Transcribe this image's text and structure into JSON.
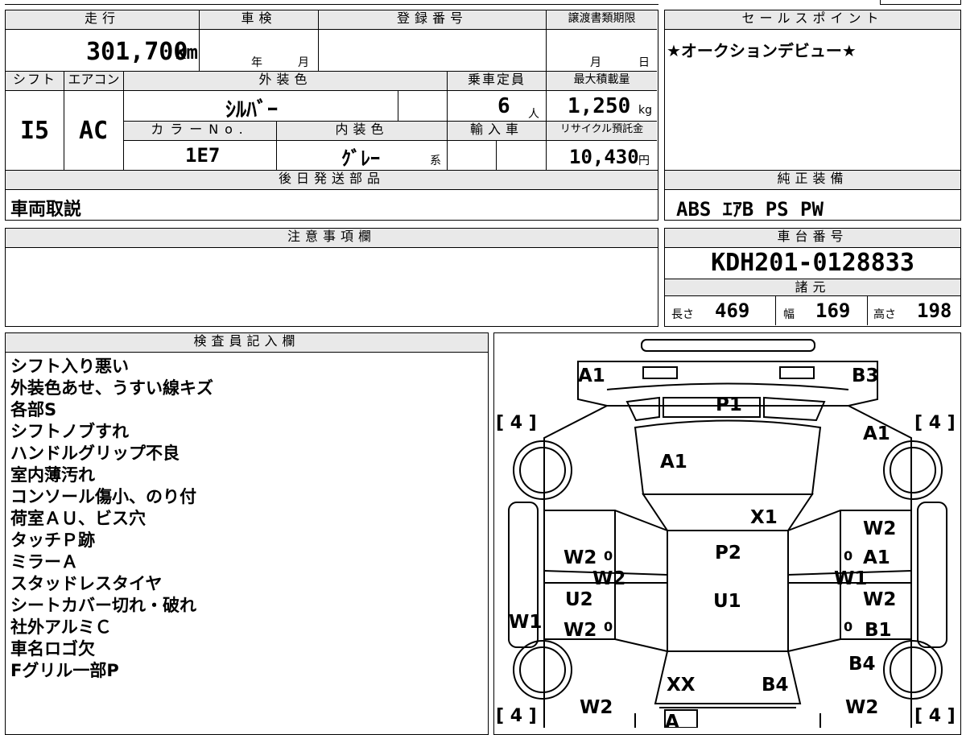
{
  "mileage": {
    "header": "走行",
    "value": "301,700",
    "unit": "km"
  },
  "inspection": {
    "header": "車検",
    "year_label": "年",
    "month_label": "月"
  },
  "registration": {
    "header": "登録番号"
  },
  "transfer_deadline": {
    "header": "譲渡書類期限",
    "month_label": "月",
    "day_label": "日"
  },
  "sales_point": {
    "header": "セールスポイント",
    "text": "★オークションデビュー★"
  },
  "shift": {
    "header": "シフト",
    "value": "I5"
  },
  "aircon": {
    "header": "エアコン",
    "value": "AC"
  },
  "exterior_color": {
    "header": "外装色",
    "value": "ｼﾙﾊﾞｰ"
  },
  "capacity": {
    "header": "乗車定員",
    "value": "6",
    "unit": "人"
  },
  "max_load": {
    "header": "最大積載量",
    "value": "1,250",
    "unit": "kg"
  },
  "color_no": {
    "header": "カラーNo.",
    "value": "1E7"
  },
  "interior_color": {
    "header": "内装色",
    "value": "ｸﾞﾚｰ",
    "suffix": "系"
  },
  "import": {
    "header": "輸入車"
  },
  "recycle": {
    "header": "リサイクル預託金",
    "value": "10,430",
    "unit": "円"
  },
  "later_parts": {
    "header": "後日発送部品",
    "value": "車両取説"
  },
  "genuine_equipment": {
    "header": "純正装備",
    "value": "ABS ｴｱB PS PW"
  },
  "caution": {
    "header": "注意事項欄"
  },
  "chassis": {
    "header": "車台番号",
    "value": "KDH201-0128833"
  },
  "specs": {
    "header": "諸元",
    "length_label": "長さ",
    "length": "469",
    "width_label": "幅",
    "width": "169",
    "height_label": "高さ",
    "height": "198"
  },
  "inspector": {
    "header": "検査員記入欄",
    "lines": [
      "シフト入り悪い",
      "外装色あせ、うすい線キズ",
      "各部S",
      "シフトノブすれ",
      "ハンドルグリップ不良",
      "室内薄汚れ",
      "コンソール傷小、のり付",
      "荷室ＡＵ、ビス穴",
      "タッチＰ跡",
      "ミラーＡ",
      "スタッドレスタイヤ",
      "シートカバー切れ・破れ",
      "社外アルミＣ",
      "車名ロゴ欠",
      "Fグリル一部P"
    ]
  },
  "diagram": {
    "tire_labels": [
      "[ 4 ]",
      "[ 4 ]",
      "[ 4 ]",
      "[ 4 ]"
    ],
    "marks": [
      "A1",
      "B3",
      "P1",
      "A1",
      "A1",
      "X1",
      "W2",
      "P2",
      "W2",
      "A1",
      "W2",
      "W1",
      "U2",
      "U1",
      "W2",
      "W1",
      "W2",
      "B1",
      "B4",
      "XX",
      "B4",
      "W2",
      "W2",
      "A"
    ],
    "small_marks": [
      "0",
      "0",
      "0",
      "0"
    ]
  }
}
